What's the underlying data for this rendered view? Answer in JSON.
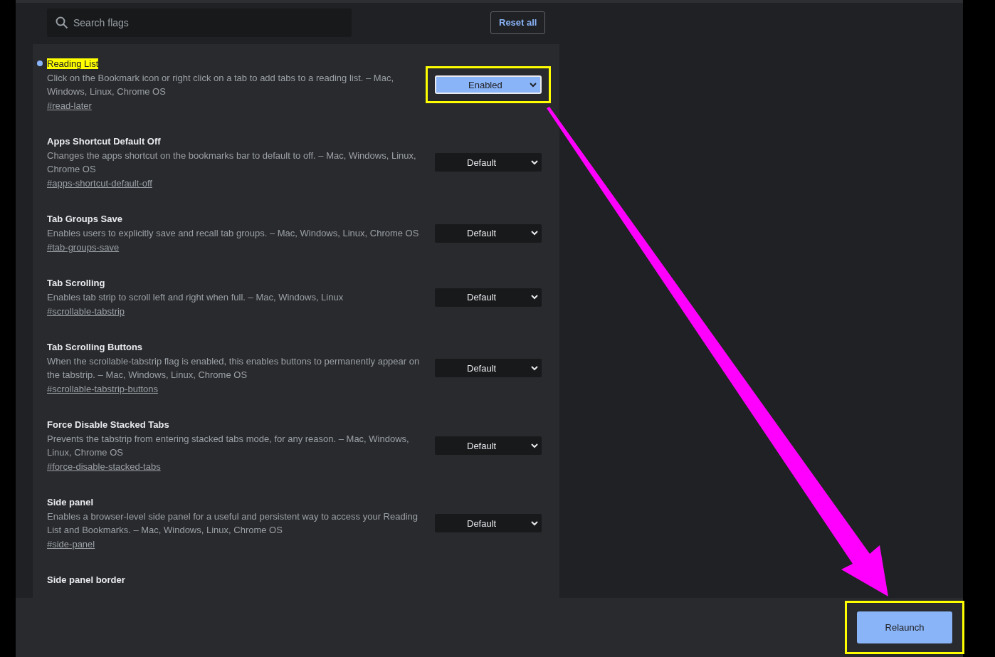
{
  "search": {
    "placeholder": "Search flags"
  },
  "reset_button": {
    "label": "Reset all"
  },
  "flags": [
    {
      "title": "Reading List",
      "title_highlighted": true,
      "modified": true,
      "description": "Click on the Bookmark icon or right click on a tab to add tabs to a reading list. – Mac, Windows, Linux, Chrome OS",
      "link": "#read-later",
      "value": "Enabled",
      "highlighted": true
    },
    {
      "title": "Apps Shortcut Default Off",
      "title_highlighted": false,
      "modified": false,
      "description": "Changes the apps shortcut on the bookmarks bar to default to off. – Mac, Windows, Linux, Chrome OS",
      "link": "#apps-shortcut-default-off",
      "value": "Default",
      "highlighted": false
    },
    {
      "title": "Tab Groups Save",
      "title_highlighted": false,
      "modified": false,
      "description": "Enables users to explicitly save and recall tab groups. – Mac, Windows, Linux, Chrome OS",
      "link": "#tab-groups-save",
      "value": "Default",
      "highlighted": false
    },
    {
      "title": "Tab Scrolling",
      "title_highlighted": false,
      "modified": false,
      "description": "Enables tab strip to scroll left and right when full. – Mac, Windows, Linux",
      "link": "#scrollable-tabstrip",
      "value": "Default",
      "highlighted": false
    },
    {
      "title": "Tab Scrolling Buttons",
      "title_highlighted": false,
      "modified": false,
      "description": "When the scrollable-tabstrip flag is enabled, this enables buttons to permanently appear on the tabstrip. – Mac, Windows, Linux, Chrome OS",
      "link": "#scrollable-tabstrip-buttons",
      "value": "Default",
      "highlighted": false
    },
    {
      "title": "Force Disable Stacked Tabs",
      "title_highlighted": false,
      "modified": false,
      "description": "Prevents the tabstrip from entering stacked tabs mode, for any reason. – Mac, Windows, Linux, Chrome OS",
      "link": "#force-disable-stacked-tabs",
      "value": "Default",
      "highlighted": false
    },
    {
      "title": "Side panel",
      "title_highlighted": false,
      "modified": false,
      "description": "Enables a browser-level side panel for a useful and persistent way to access your Reading List and Bookmarks. – Mac, Windows, Linux, Chrome OS",
      "link": "#side-panel",
      "value": "Default",
      "highlighted": false
    },
    {
      "title": "Side panel border",
      "title_highlighted": false,
      "modified": false
    }
  ],
  "relaunch_button": {
    "label": "Relaunch",
    "highlighted": true
  }
}
